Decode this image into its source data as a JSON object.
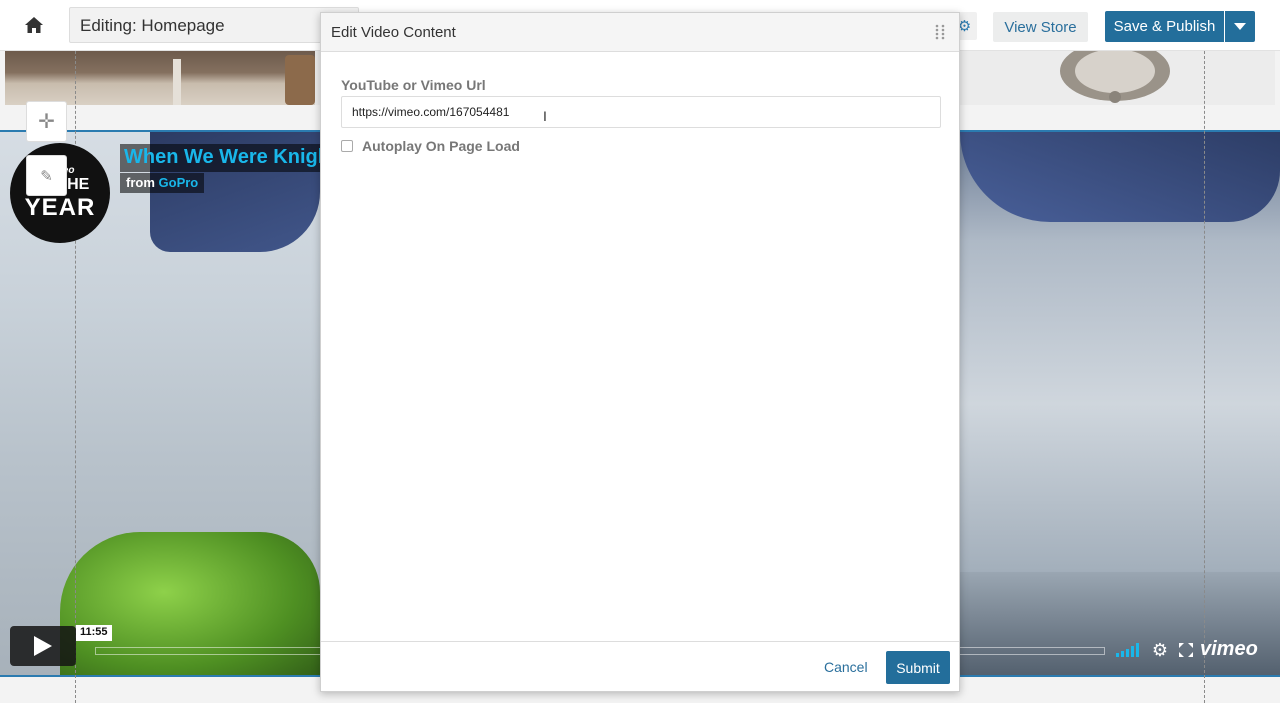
{
  "topbar": {
    "editing_label": "Editing: Homepage",
    "view_store_label": "View Store",
    "publish_label": "Save & Publish"
  },
  "video": {
    "title": "When We Were Knigl",
    "from_prefix": "from",
    "from_channel": "GoPro",
    "badge_vimeo": "vimeo",
    "badge_line1": "OF THE",
    "badge_line2": "YEAR",
    "timecode": "11:55",
    "logo": "vimeo"
  },
  "modal": {
    "title": "Edit Video Content",
    "url_label": "YouTube or Vimeo Url",
    "url_value": "https://vimeo.com/167054481",
    "autoplay_label": "Autoplay On Page Load",
    "cancel_label": "Cancel",
    "submit_label": "Submit"
  },
  "colors": {
    "primary": "#236e9b",
    "link": "#2a6f9c",
    "video_title": "#19b7ea"
  }
}
